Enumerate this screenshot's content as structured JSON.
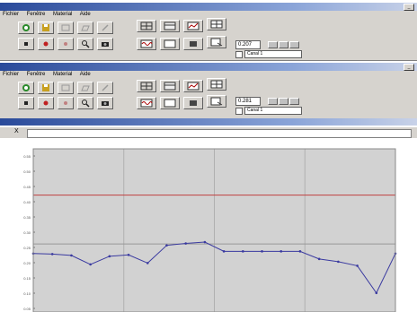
{
  "window1": {
    "title": "",
    "menu": [
      "Fichier",
      "Fenêtre",
      "Material",
      "Aide"
    ],
    "readout": "0.207",
    "channel": "Canal 1"
  },
  "window2": {
    "title": "",
    "menu": [
      "Fichier",
      "Fenêtre",
      "Material",
      "Aide"
    ],
    "readout": "0.281",
    "channel": "Canal 1"
  },
  "graph_window": {
    "title": "",
    "address": "",
    "left_marker": "X"
  },
  "toolbar_icons": [
    "recorder-icon",
    "save-icon",
    "disk-icon",
    "open-icon",
    "edit-icon",
    "grid-icon",
    "table-icon",
    "chart-icon",
    "layout-icon",
    "stop-icon",
    "record-icon",
    "pause-icon",
    "zoom-icon",
    "camera-icon",
    "wave-icon",
    "window-icon",
    "marker-icon",
    "export-icon"
  ],
  "colors": {
    "plot_bg": "#d2d2d2",
    "series": "#3a3aa0",
    "threshold": "#c04040",
    "title_start": "#2a4a9a"
  },
  "chart_data": {
    "type": "line",
    "title": "",
    "xlabel": "",
    "ylabel": "",
    "ylim": [
      0,
      0.6
    ],
    "ytick_labels": [
      "0.55",
      "0.50",
      "0.45",
      "0.40",
      "0.35",
      "0.30",
      "0.25",
      "0.20",
      "0.15",
      "0.10",
      "0.05"
    ],
    "grid": true,
    "threshold": 0.43,
    "series": [
      {
        "values": [
          0.215,
          0.213,
          0.208,
          0.175,
          0.205,
          0.21,
          0.18,
          0.245,
          0.252,
          0.257,
          0.223,
          0.223,
          0.223,
          0.223,
          0.223,
          0.195,
          0.185,
          0.17,
          0.07,
          0.215
        ]
      }
    ]
  }
}
